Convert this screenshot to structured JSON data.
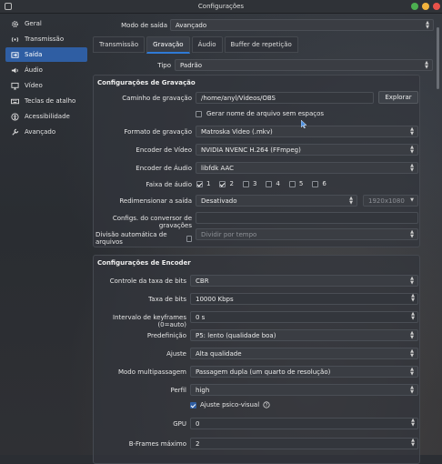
{
  "window": {
    "title": "Configurações"
  },
  "sidebar": {
    "items": [
      {
        "label": "Geral",
        "icon": "gear-icon"
      },
      {
        "label": "Transmissão",
        "icon": "broadcast-icon"
      },
      {
        "label": "Saída",
        "icon": "output-icon",
        "active": true
      },
      {
        "label": "Áudio",
        "icon": "speaker-icon"
      },
      {
        "label": "Vídeo",
        "icon": "monitor-icon"
      },
      {
        "label": "Teclas de atalho",
        "icon": "keyboard-icon"
      },
      {
        "label": "Acessibilidade",
        "icon": "accessibility-icon"
      },
      {
        "label": "Avançado",
        "icon": "wrench-icon"
      }
    ]
  },
  "output_mode": {
    "label": "Modo de saída",
    "value": "Avançado"
  },
  "tabs": [
    {
      "label": "Transmissão"
    },
    {
      "label": "Gravação",
      "active": true
    },
    {
      "label": "Áudio"
    },
    {
      "label": "Buffer de repetição"
    }
  ],
  "type": {
    "label": "Tipo",
    "value": "Padrão"
  },
  "recording": {
    "title": "Configurações de Gravação",
    "path_label": "Caminho de gravação",
    "path_value": "/home/anyl/Videos/OBS",
    "browse_label": "Explorar",
    "nospace_label": "Gerar nome de arquivo sem espaços",
    "format_label": "Formato de gravação",
    "format_value": "Matroska Video (.mkv)",
    "video_encoder_label": "Encoder de Vídeo",
    "video_encoder_value": "NVIDIA NVENC H.264 (FFmpeg)",
    "audio_encoder_label": "Encoder de Áudio",
    "audio_encoder_value": "libfdk AAC",
    "audio_track_label": "Faixa de áudio",
    "tracks": [
      "1",
      "2",
      "3",
      "4",
      "5",
      "6"
    ],
    "rescale_label": "Redimensionar a saída",
    "rescale_value": "Desativado",
    "rescale_res": "1920x1080",
    "muxer_label": "Configs. do conversor de gravações",
    "autosplit_label": "Divisão automática de arquivos",
    "autosplit_value": "Dividir por tempo"
  },
  "encoder": {
    "title": "Configurações de Encoder",
    "rate_control_label": "Controle da taxa de bits",
    "rate_control_value": "CBR",
    "bitrate_label": "Taxa de bits",
    "bitrate_value": "10000 Kbps",
    "keyframe_label": "Intervalo de keyframes (0=auto)",
    "keyframe_value": "0 s",
    "preset_label": "Predefinição",
    "preset_value": "P5: lento (qualidade boa)",
    "tuning_label": "Ajuste",
    "tuning_value": "Alta qualidade",
    "multipass_label": "Modo multipassagem",
    "multipass_value": "Passagem dupla (um quarto de resolução)",
    "profile_label": "Perfil",
    "profile_value": "high",
    "psycho_label": "Ajuste psico-visual",
    "gpu_label": "GPU",
    "gpu_value": "0",
    "bframes_label": "B-Frames máximo",
    "bframes_value": "2"
  },
  "colors": {
    "accent": "#2f5ea3",
    "tab_accent": "#2f7ad6"
  }
}
